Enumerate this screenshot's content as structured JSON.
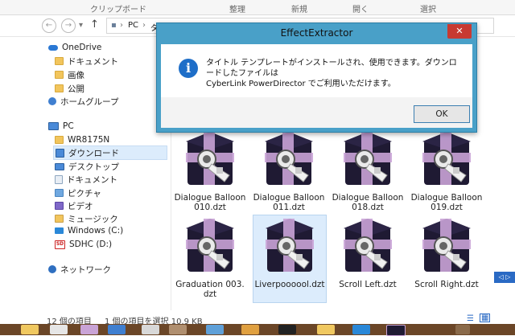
{
  "ribbon": {
    "groups": [
      "クリップボード",
      "整理",
      "新規",
      "開く",
      "選択"
    ]
  },
  "address": {
    "back_label": "←",
    "forward_label": "→",
    "up_label": "↑",
    "crumbs": [
      "PC",
      "ダ"
    ]
  },
  "sidebar": {
    "items": [
      {
        "label": "OneDrive",
        "icon": "cloud-icon"
      },
      {
        "label": "ドキュメント",
        "icon": "folder-icon"
      },
      {
        "label": "画像",
        "icon": "folder-icon"
      },
      {
        "label": "公開",
        "icon": "folder-icon"
      },
      {
        "label": "ホームグループ",
        "icon": "homegroup-icon"
      },
      {
        "label": "PC",
        "icon": "pc-icon"
      },
      {
        "label": "WR8175N",
        "icon": "folder-icon"
      },
      {
        "label": "ダウンロード",
        "icon": "download-folder-icon"
      },
      {
        "label": "デスクトップ",
        "icon": "desktop-folder-icon"
      },
      {
        "label": "ドキュメント",
        "icon": "documents-folder-icon"
      },
      {
        "label": "ピクチャ",
        "icon": "pictures-folder-icon"
      },
      {
        "label": "ビデオ",
        "icon": "videos-folder-icon"
      },
      {
        "label": "ミュージック",
        "icon": "music-folder-icon"
      },
      {
        "label": "Windows (C:)",
        "icon": "windows-drive-icon"
      },
      {
        "label": "SDHC (D:)",
        "icon": "sd-card-icon"
      },
      {
        "label": "ネットワーク",
        "icon": "network-icon"
      }
    ]
  },
  "files": [
    {
      "name": "Dialogue Balloon 010.dzt"
    },
    {
      "name": "Dialogue Balloon 011.dzt"
    },
    {
      "name": "Dialogue Balloon 018.dzt"
    },
    {
      "name": "Dialogue Balloon 019.dzt"
    },
    {
      "name": "Graduation 003.dzt"
    },
    {
      "name": "Liverpoooool.dzt"
    },
    {
      "name": "Scroll Left.dzt"
    },
    {
      "name": "Scroll Right.dzt"
    }
  ],
  "status": {
    "count": "12 個の項目",
    "selection": "1 個の項目を選択 10.9 KB"
  },
  "dialog": {
    "title": "EffectExtractor",
    "close_label": "✕",
    "message_line1": "タイトル テンプレートがインストールされ、使用できます。ダウンロードしたファイルは",
    "message_line2": "CyberLink PowerDirector でご利用いただけます。",
    "ok_label": "OK"
  },
  "colors": {
    "dialog_frame": "#49a0c8",
    "close_button": "#c73a32",
    "taskbar": "#6b4627",
    "selection": "#dcecfc",
    "box_dark": "#1f1a33",
    "ribbon_pink": "#c9a3d6"
  }
}
